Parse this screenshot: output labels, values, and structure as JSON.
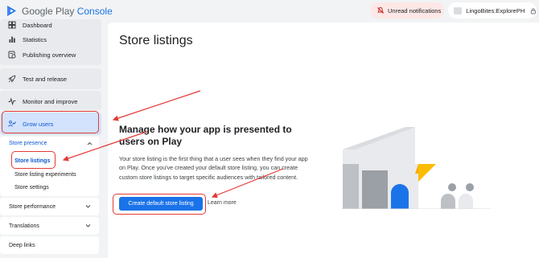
{
  "header": {
    "logo_text_1": "Google Play",
    "logo_text_2": "Console",
    "notification_label": "Unread notifications",
    "account_name": "LingoBites:ExplorePH"
  },
  "sidebar": {
    "top_items": [
      {
        "label": "Dashboard",
        "icon": "dashboard-icon"
      },
      {
        "label": "Statistics",
        "icon": "bar-chart-icon"
      },
      {
        "label": "Publishing overview",
        "icon": "publishing-icon"
      }
    ],
    "test_release": {
      "label": "Test and release",
      "icon": "rocket-icon"
    },
    "monitor": {
      "label": "Monitor and improve",
      "icon": "pulse-icon"
    },
    "grow_users": {
      "label": "Grow users",
      "icon": "grow-users-icon"
    },
    "store_presence": {
      "label": "Store presence",
      "items": [
        {
          "label": "Store listings",
          "selected": true
        },
        {
          "label": "Store listing experiments"
        },
        {
          "label": "Store settings"
        }
      ]
    },
    "sections": [
      {
        "label": "Store performance"
      },
      {
        "label": "Translations"
      },
      {
        "label": "Deep links"
      }
    ]
  },
  "main": {
    "title": "Store listings",
    "heading": "Manage how your app is presented to users on Play",
    "description": "Your store listing is the first thing that a user sees when they find your app on Play. Once you've created your default store listing, you can create custom store listings to target specific audiences with tailored content.",
    "primary_button": "Create default store listing",
    "learn_more": "Learn more"
  },
  "colors": {
    "accent": "#1a73e8",
    "annotation": "#e53935",
    "sidebar_selected": "#d3e3fd",
    "notification_bg": "#fce8e6"
  }
}
